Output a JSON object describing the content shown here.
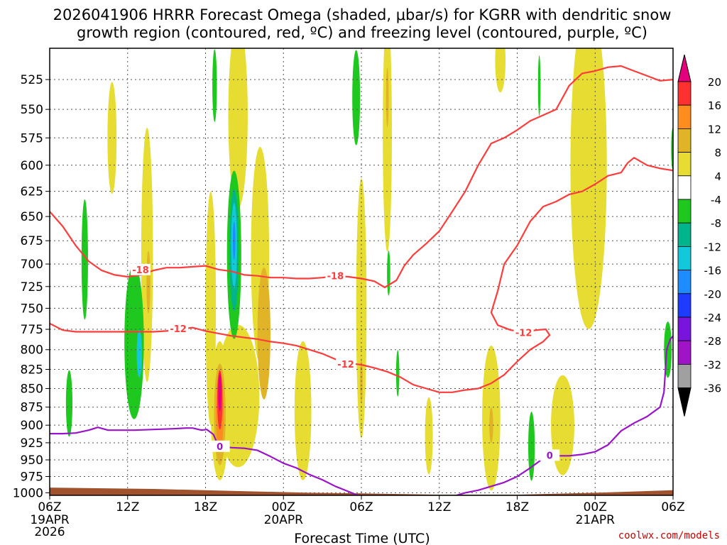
{
  "chart_data": {
    "type": "heatmap",
    "title_line1": "2026041906 HRRR Forecast Omega (shaded, μbar/s) for KGRR with dendritic snow",
    "title_line2": "growth region (contoured, red, ºC) and freezing level (contoured, purple, ºC)",
    "xlabel": "Forecast Time (UTC)",
    "credit": "coolwx.com/models",
    "x_range_hours": [
      0,
      48
    ],
    "y_range_hpa": [
      1004,
      500
    ],
    "y_scale": "log-pressure",
    "grid": "dotted",
    "x_ticks": [
      {
        "h": 0,
        "label": "06Z",
        "date": "19APR",
        "year": "2026"
      },
      {
        "h": 6,
        "label": "12Z",
        "date": "",
        "year": ""
      },
      {
        "h": 12,
        "label": "18Z",
        "date": "",
        "year": ""
      },
      {
        "h": 18,
        "label": "00Z",
        "date": "20APR",
        "year": ""
      },
      {
        "h": 24,
        "label": "06Z",
        "date": "",
        "year": ""
      },
      {
        "h": 30,
        "label": "12Z",
        "date": "",
        "year": ""
      },
      {
        "h": 36,
        "label": "18Z",
        "date": "",
        "year": ""
      },
      {
        "h": 42,
        "label": "00Z",
        "date": "21APR",
        "year": ""
      },
      {
        "h": 48,
        "label": "06Z",
        "date": "",
        "year": ""
      }
    ],
    "y_ticks": [
      "525",
      "550",
      "575",
      "600",
      "625",
      "650",
      "675",
      "700",
      "725",
      "750",
      "775",
      "800",
      "825",
      "850",
      "875",
      "900",
      "925",
      "950",
      "975",
      "1000"
    ],
    "colorbar": {
      "labels": [
        "20",
        "16",
        "12",
        "8",
        "4",
        "-4",
        "-8",
        "-12",
        "-16",
        "-20",
        "-24",
        "-28",
        "-32",
        "-36"
      ],
      "colors": [
        "#e4007c",
        "#ff3030",
        "#ff8c1e",
        "#e1b428",
        "#e6dc32",
        "#ffffff",
        "#1ec81e",
        "#00b48c",
        "#14c8dc",
        "#1e8cff",
        "#1e3cff",
        "#7814dc",
        "#a014c8",
        "#a0a0a0",
        "#000000"
      ],
      "top_arrow": "#e4007c",
      "bottom_arrow": "#000000"
    },
    "omega_regions": [
      {
        "h": 4.8,
        "p": 575,
        "dh": 0.7,
        "dp": 100,
        "c": "#e6dc32"
      },
      {
        "h": 7.5,
        "p": 690,
        "dh": 0.9,
        "dp": 270,
        "c": "#e6dc32"
      },
      {
        "h": 7.6,
        "p": 720,
        "dh": 0.3,
        "dp": 70,
        "c": "#e1b428"
      },
      {
        "h": 12.4,
        "p": 750,
        "dh": 0.8,
        "dp": 270,
        "c": "#e6dc32"
      },
      {
        "h": 14.5,
        "p": 555,
        "dh": 1.5,
        "dp": 160,
        "c": "#e6dc32"
      },
      {
        "h": 16.2,
        "p": 690,
        "dh": 1.4,
        "dp": 230,
        "c": "#e6dc32"
      },
      {
        "h": 16.5,
        "p": 780,
        "dh": 1.0,
        "dp": 160,
        "c": "#e1b428"
      },
      {
        "h": 14.5,
        "p": 860,
        "dh": 3.3,
        "dp": 190,
        "c": "#e6dc32"
      },
      {
        "h": 13.1,
        "p": 880,
        "dh": 1.4,
        "dp": 190,
        "c": "#e6dc32"
      },
      {
        "h": 13.1,
        "p": 885,
        "dh": 0.9,
        "dp": 140,
        "c": "#e1b428"
      },
      {
        "h": 13.1,
        "p": 880,
        "dh": 0.6,
        "dp": 110,
        "c": "#ff8c1e"
      },
      {
        "h": 13.1,
        "p": 865,
        "dh": 0.4,
        "dp": 80,
        "c": "#ff3030"
      },
      {
        "h": 13.1,
        "p": 855,
        "dh": 0.25,
        "dp": 50,
        "c": "#e4007c"
      },
      {
        "h": 19.5,
        "p": 880,
        "dh": 1.3,
        "dp": 190,
        "c": "#e6dc32"
      },
      {
        "h": 24.0,
        "p": 750,
        "dh": 0.8,
        "dp": 300,
        "c": "#e6dc32"
      },
      {
        "h": 24.0,
        "p": 840,
        "dh": 0.2,
        "dp": 60,
        "c": "#e1b428"
      },
      {
        "h": 26.0,
        "p": 570,
        "dh": 0.7,
        "dp": 210,
        "c": "#e6dc32"
      },
      {
        "h": 26.0,
        "p": 540,
        "dh": 0.2,
        "dp": 50,
        "c": "#e1b428"
      },
      {
        "h": 29.2,
        "p": 915,
        "dh": 0.6,
        "dp": 110,
        "c": "#e6dc32"
      },
      {
        "h": 34.0,
        "p": 890,
        "dh": 1.4,
        "dp": 200,
        "c": "#e6dc32"
      },
      {
        "h": 34.0,
        "p": 900,
        "dh": 0.3,
        "dp": 50,
        "c": "#e1b428"
      },
      {
        "h": 34.7,
        "p": 510,
        "dh": 0.8,
        "dp": 50,
        "c": "#e6dc32"
      },
      {
        "h": 39.5,
        "p": 900,
        "dh": 1.8,
        "dp": 140,
        "c": "#e6dc32"
      },
      {
        "h": 41.5,
        "p": 600,
        "dh": 2.8,
        "dp": 300,
        "c": "#e6dc32"
      }
    ],
    "green_regions": [
      {
        "h": 1.5,
        "p": 870,
        "dh": 0.5,
        "dp": 90,
        "c": "#1ec81e"
      },
      {
        "h": 2.7,
        "p": 695,
        "dh": 0.5,
        "dp": 130,
        "c": "#1ec81e"
      },
      {
        "h": 6.5,
        "p": 790,
        "dh": 1.5,
        "dp": 190,
        "c": "#1ec81e"
      },
      {
        "h": 6.9,
        "p": 805,
        "dh": 0.4,
        "dp": 60,
        "c": "#14c8dc"
      },
      {
        "h": 12.7,
        "p": 530,
        "dh": 0.35,
        "dp": 60,
        "c": "#1ec81e"
      },
      {
        "h": 14.2,
        "p": 690,
        "dh": 1.1,
        "dp": 180,
        "c": "#1ec81e"
      },
      {
        "h": 14.2,
        "p": 685,
        "dh": 0.7,
        "dp": 130,
        "c": "#00b48c"
      },
      {
        "h": 14.2,
        "p": 680,
        "dh": 0.45,
        "dp": 90,
        "c": "#14c8dc"
      },
      {
        "h": 14.2,
        "p": 675,
        "dh": 0.2,
        "dp": 40,
        "c": "#1e8cff"
      },
      {
        "h": 23.6,
        "p": 540,
        "dh": 0.6,
        "dp": 80,
        "c": "#1ec81e"
      },
      {
        "h": 26.1,
        "p": 710,
        "dh": 0.25,
        "dp": 50,
        "c": "#1ec81e"
      },
      {
        "h": 26.8,
        "p": 830,
        "dh": 0.25,
        "dp": 60,
        "c": "#1ec81e"
      },
      {
        "h": 37.1,
        "p": 930,
        "dh": 0.5,
        "dp": 100,
        "c": "#1ec81e"
      },
      {
        "h": 37.7,
        "p": 530,
        "dh": 0.2,
        "dp": 50,
        "c": "#1ec81e"
      },
      {
        "h": 47.6,
        "p": 800,
        "dh": 0.6,
        "dp": 70,
        "c": "#1ec81e"
      },
      {
        "h": 48.0,
        "p": 585,
        "dh": 0.3,
        "dp": 40,
        "c": "#1ec81e"
      }
    ],
    "series": [
      {
        "name": "-18",
        "color": "#ff3c3c",
        "label_at": [
          7.0,
          706
        ],
        "label2_at": [
          22.0,
          713
        ],
        "points": [
          [
            0,
            645
          ],
          [
            1,
            660
          ],
          [
            2,
            680
          ],
          [
            3,
            697
          ],
          [
            4,
            707
          ],
          [
            5,
            712
          ],
          [
            6,
            714
          ],
          [
            7,
            712
          ],
          [
            8,
            707
          ],
          [
            9,
            704
          ],
          [
            10,
            704
          ],
          [
            11,
            703
          ],
          [
            12,
            702
          ],
          [
            13,
            706
          ],
          [
            14,
            708
          ],
          [
            15,
            712
          ],
          [
            16,
            713
          ],
          [
            17,
            715
          ],
          [
            18,
            715
          ],
          [
            19,
            716
          ],
          [
            20,
            716
          ],
          [
            21,
            715
          ],
          [
            22,
            713
          ],
          [
            23,
            714
          ],
          [
            24,
            716
          ],
          [
            25,
            719
          ],
          [
            25.8,
            726
          ],
          [
            26.7,
            718
          ],
          [
            27.3,
            702
          ],
          [
            28,
            690
          ],
          [
            29,
            678
          ],
          [
            30,
            665
          ],
          [
            31,
            645
          ],
          [
            32,
            625
          ],
          [
            33,
            600
          ],
          [
            34,
            580
          ],
          [
            35,
            575
          ],
          [
            36,
            568
          ],
          [
            37,
            560
          ],
          [
            38,
            555
          ],
          [
            39,
            550
          ],
          [
            40,
            530
          ],
          [
            41,
            520
          ],
          [
            42,
            518
          ],
          [
            43,
            515
          ],
          [
            44,
            514
          ],
          [
            45,
            518
          ],
          [
            46,
            522
          ],
          [
            47,
            526
          ],
          [
            48,
            525
          ]
        ]
      },
      {
        "name": "-12",
        "color": "#ff3c3c",
        "label_at": [
          9.9,
          774
        ],
        "label2_at": [
          22.8,
          818
        ],
        "label3_at": [
          36.5,
          779
        ],
        "points": [
          [
            0,
            768
          ],
          [
            1,
            776
          ],
          [
            2,
            778
          ],
          [
            3,
            778
          ],
          [
            4,
            778
          ],
          [
            5,
            778
          ],
          [
            6,
            778
          ],
          [
            7,
            778
          ],
          [
            8,
            778
          ],
          [
            9,
            777
          ],
          [
            10,
            775
          ],
          [
            11,
            773
          ],
          [
            12,
            777
          ],
          [
            13,
            780
          ],
          [
            14,
            783
          ],
          [
            15,
            785
          ],
          [
            16,
            787
          ],
          [
            17,
            790
          ],
          [
            18,
            792
          ],
          [
            19,
            795
          ],
          [
            20,
            800
          ],
          [
            21,
            805
          ],
          [
            22,
            812
          ],
          [
            23,
            817
          ],
          [
            24,
            819
          ],
          [
            25,
            823
          ],
          [
            26,
            828
          ],
          [
            27,
            835
          ],
          [
            28,
            845
          ],
          [
            29,
            850
          ],
          [
            30,
            855
          ],
          [
            31,
            855
          ],
          [
            32,
            852
          ],
          [
            33,
            850
          ],
          [
            34,
            843
          ],
          [
            35,
            832
          ],
          [
            36,
            815
          ],
          [
            37,
            800
          ],
          [
            38,
            790
          ],
          [
            38.5,
            782
          ],
          [
            38.2,
            775
          ],
          [
            37.5,
            776
          ],
          [
            36.5,
            778
          ],
          [
            35.5,
            776
          ],
          [
            34.5,
            770
          ],
          [
            34,
            755
          ],
          [
            34.5,
            730
          ],
          [
            35,
            700
          ],
          [
            36,
            680
          ],
          [
            37,
            655
          ],
          [
            38,
            640
          ],
          [
            39,
            635
          ],
          [
            40,
            628
          ],
          [
            41,
            625
          ],
          [
            42,
            618
          ],
          [
            43,
            610
          ],
          [
            44,
            607
          ],
          [
            44.5,
            598
          ],
          [
            45,
            593
          ],
          [
            46,
            600
          ],
          [
            47,
            603
          ],
          [
            48,
            605
          ]
        ]
      },
      {
        "name": "0",
        "color": "#9914c8",
        "label_at": [
          13.1,
          930
        ],
        "label2_at": [
          38.5,
          943
        ],
        "points": [
          [
            0,
            912
          ],
          [
            1,
            912
          ],
          [
            2,
            911
          ],
          [
            3,
            907
          ],
          [
            3.7,
            903
          ],
          [
            4.5,
            907
          ],
          [
            5.5,
            907
          ],
          [
            6.5,
            907
          ],
          [
            8,
            906
          ],
          [
            9.5,
            905
          ],
          [
            10.5,
            904
          ],
          [
            11,
            904
          ],
          [
            11.7,
            907
          ],
          [
            12.1,
            906
          ],
          [
            12.6,
            913
          ],
          [
            13,
            930
          ],
          [
            14,
            932
          ],
          [
            15,
            933
          ],
          [
            16,
            936
          ],
          [
            17,
            945
          ],
          [
            18,
            955
          ],
          [
            19,
            962
          ],
          [
            20,
            972
          ],
          [
            21,
            980
          ],
          [
            22,
            990
          ],
          [
            23,
            998
          ],
          [
            23.7,
            1004
          ],
          [
            25,
            1006
          ],
          [
            31,
            1006
          ],
          [
            32,
            1000
          ],
          [
            33,
            996
          ],
          [
            34,
            990
          ],
          [
            35,
            984
          ],
          [
            36,
            975
          ],
          [
            37,
            962
          ],
          [
            38,
            948
          ],
          [
            39,
            944
          ],
          [
            40,
            944
          ],
          [
            41,
            942
          ],
          [
            42,
            938
          ],
          [
            43,
            928
          ],
          [
            44,
            908
          ],
          [
            45,
            897
          ],
          [
            46,
            888
          ],
          [
            47,
            875
          ],
          [
            47.3,
            855
          ],
          [
            47.4,
            830
          ],
          [
            47.5,
            800
          ],
          [
            47.8,
            787
          ],
          [
            48.3,
            778
          ],
          [
            49,
            778
          ]
        ]
      }
    ],
    "ground_top_hpa": [
      [
        0,
        992
      ],
      [
        8,
        994
      ],
      [
        14,
        997
      ],
      [
        20,
        1000
      ],
      [
        24,
        1001
      ],
      [
        30,
        1003
      ],
      [
        36,
        1003
      ],
      [
        42,
        1000
      ],
      [
        48,
        996
      ]
    ]
  }
}
